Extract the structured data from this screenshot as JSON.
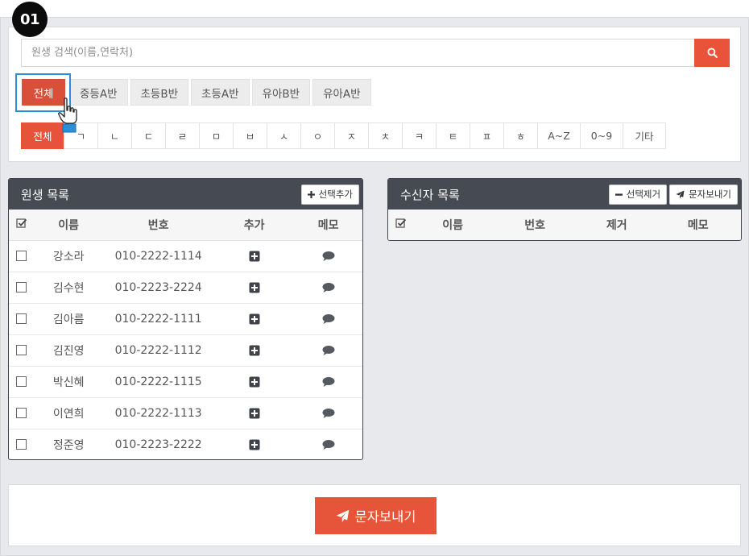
{
  "step": {
    "badge": "01"
  },
  "search": {
    "placeholder": "원생 검색(이름,연락처)",
    "value": ""
  },
  "class_filters": [
    "전체",
    "중등A반",
    "초등B반",
    "초등A반",
    "유아B반",
    "유아A반"
  ],
  "consonant_filters": [
    "전체",
    "ㄱ",
    "ㄴ",
    "ㄷ",
    "ㄹ",
    "ㅁ",
    "ㅂ",
    "ㅅ",
    "ㅇ",
    "ㅈ",
    "ㅊ",
    "ㅋ",
    "ㅌ",
    "ㅍ",
    "ㅎ",
    "A~Z",
    "0~9",
    "기타"
  ],
  "student_list": {
    "title": "원생 목록",
    "add_selected_label": "선택추가",
    "columns": {
      "name": "이름",
      "number": "번호",
      "add": "추가",
      "memo": "메모"
    },
    "rows": [
      {
        "name": "강소라",
        "number": "010-2222-1114"
      },
      {
        "name": "김수현",
        "number": "010-2223-2224"
      },
      {
        "name": "김아름",
        "number": "010-2222-1111"
      },
      {
        "name": "김진영",
        "number": "010-2222-1112"
      },
      {
        "name": "박신혜",
        "number": "010-2222-1115"
      },
      {
        "name": "이연희",
        "number": "010-2222-1113"
      },
      {
        "name": "정준영",
        "number": "010-2223-2222"
      }
    ]
  },
  "recipient_list": {
    "title": "수신자 목록",
    "remove_selected_label": "선택제거",
    "send_label": "문자보내기",
    "columns": {
      "name": "이름",
      "number": "번호",
      "remove": "제거",
      "memo": "메모"
    }
  },
  "footer": {
    "send_label": "문자보내기"
  },
  "colors": {
    "accent": "#e6543a",
    "header_dark": "#454a53",
    "highlight": "#2a8fd8"
  }
}
